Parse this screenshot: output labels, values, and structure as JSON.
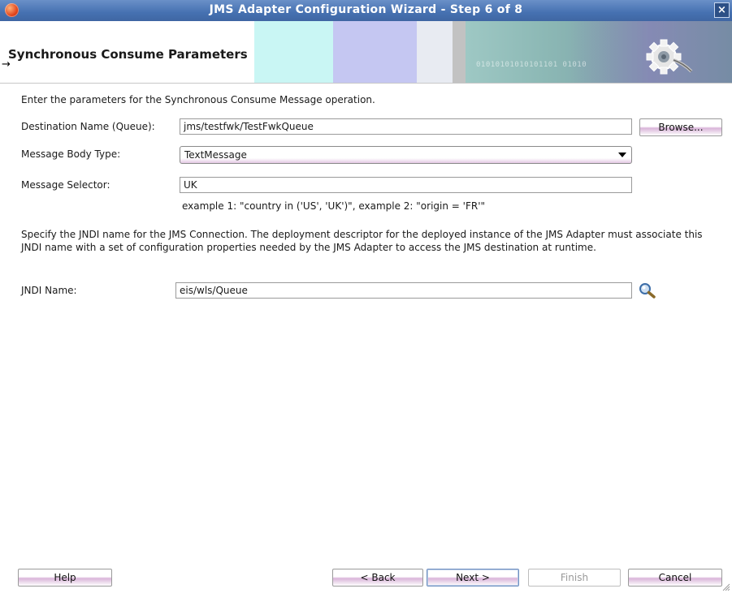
{
  "window": {
    "title": "JMS Adapter Configuration Wizard - Step 6 of 8",
    "close_glyph": "×"
  },
  "banner": {
    "heading": "Synchronous Consume Parameters",
    "arrow_glyph": "→",
    "binary_text": "01010101010101101 01010"
  },
  "intro": "Enter the parameters for the Synchronous Consume Message operation.",
  "destination": {
    "label": "Destination Name (Queue):",
    "value": "jms/testfwk/TestFwkQueue",
    "browse_label": "Browse..."
  },
  "message_body_type": {
    "label": "Message Body Type:",
    "value": "TextMessage"
  },
  "message_selector": {
    "label": "Message Selector:",
    "value": "UK",
    "example": "example 1: \"country in ('US', 'UK')\", example 2: \"origin = 'FR'\""
  },
  "jndi": {
    "description": "Specify the JNDI name for the JMS Connection.  The deployment descriptor for the deployed instance of the JMS Adapter must associate this JNDI name with a set of configuration properties needed by the JMS Adapter to access the JMS destination at runtime.",
    "label": "JNDI Name:",
    "value": "eis/wls/Queue"
  },
  "footer": {
    "help": "Help",
    "back": "< Back",
    "next": "Next >",
    "finish": "Finish",
    "cancel": "Cancel"
  },
  "colors": {
    "title_bar": "#4671b1",
    "button_accent": "#d9b4d9"
  },
  "icons": [
    "app-icon",
    "close-icon",
    "gear-icon",
    "search-icon",
    "resize-grip-icon"
  ]
}
